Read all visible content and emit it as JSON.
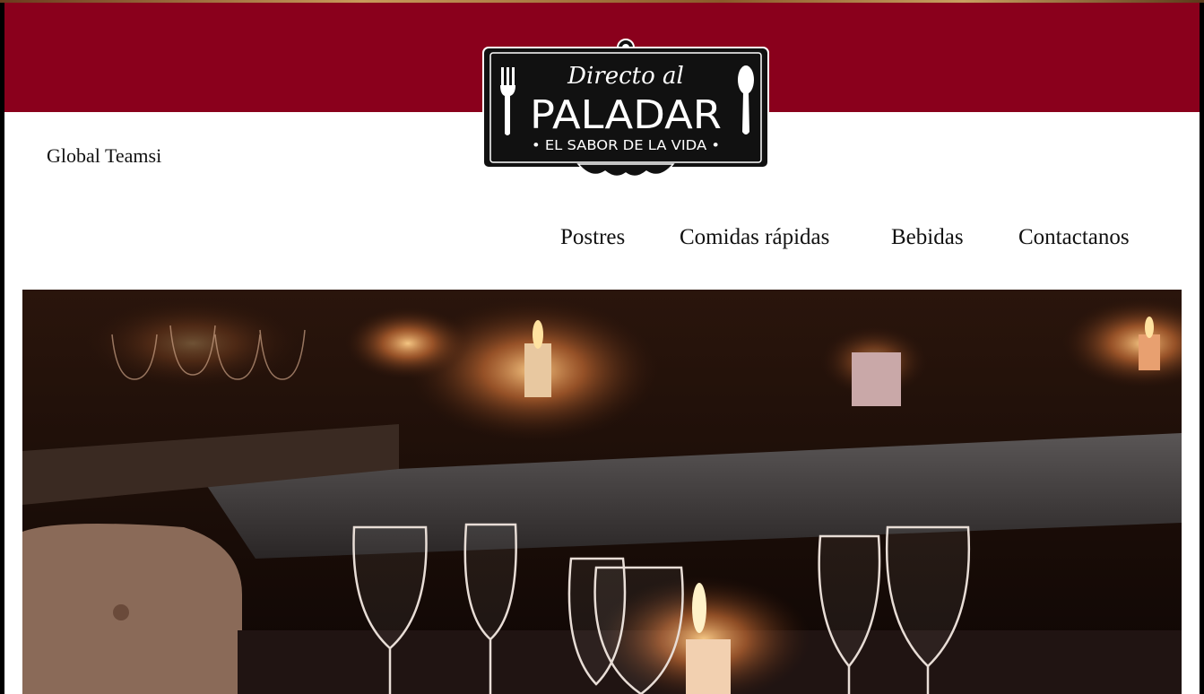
{
  "header": {
    "brand_name": "Global Teamsi",
    "logo": {
      "script_line": "Directo al",
      "title": "PALADAR",
      "tagline": "• EL SABOR DE LA VIDA •",
      "icons": [
        "fork-icon",
        "spoon-icon"
      ]
    }
  },
  "nav": {
    "items": [
      {
        "label": "Postres"
      },
      {
        "label": "Comidas rápidas"
      },
      {
        "label": "Bebidas"
      },
      {
        "label": "Contactanos"
      }
    ]
  },
  "hero": {
    "image": "restaurant-candlelit-table-with-wine-glasses"
  },
  "colors": {
    "banner": "#8a001c",
    "logo_bg": "#111111",
    "text": "#111111"
  }
}
